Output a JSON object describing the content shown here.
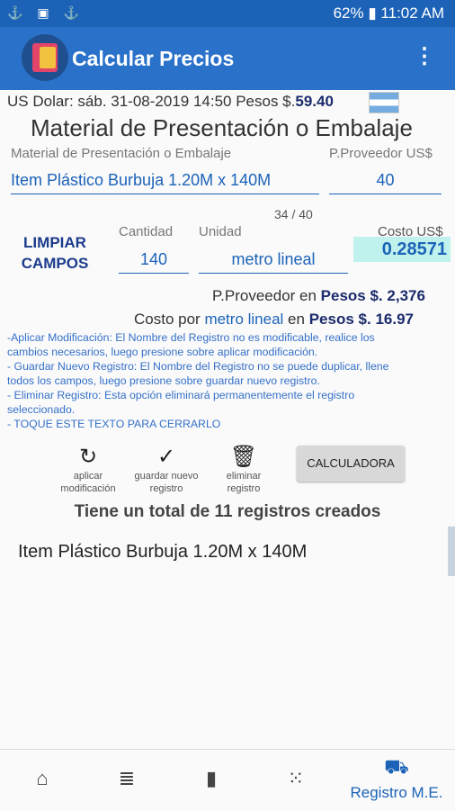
{
  "status": {
    "left_icons": "⚓ ▣ ⚓",
    "right": "62% ▮ 11:02 AM"
  },
  "appbar": {
    "title": "Calcular Precios",
    "menu_icon": "⋮"
  },
  "rate": {
    "prefix": "US Dolar: sáb. 31-08-2019 14:50 Pesos $.",
    "value": "59.40"
  },
  "heading": "Material de Presentación o Embalaje",
  "form": {
    "material_label": "Material de Presentación o Embalaje",
    "material_value": "Item Plástico Burbuja 1.20M x 140M",
    "proveedor_label": "P.Proveedor US$",
    "proveedor_value": "40",
    "counter": "34 / 40",
    "limpiar": "LIMPIAR CAMPOS",
    "cantidad_label": "Cantidad",
    "cantidad_value": "140",
    "unidad_label": "Unidad",
    "unidad_value": "metro lineal",
    "costo_label": "Costo US$",
    "costo_value": "0.28571"
  },
  "summary": {
    "proveedor_pesos_label": "P.Proveedor en",
    "pesos_label": "Pesos $.",
    "proveedor_pesos_value": "2,376",
    "costo_por_label": "Costo por",
    "costo_por_unit": "metro lineal",
    "en_label": "en",
    "costo_por_value": "16.97"
  },
  "help": [
    "-Aplicar Modificación: El Nombre del Registro no es modificable, realice los",
    "cambios necesarios, luego presione sobre aplicar modificación.",
    "- Guardar Nuevo Registro: El Nombre del Registro no se puede duplicar, llene",
    "todos los campos, luego presione sobre guardar nuevo registro.",
    "- Eliminar Registro: Esta opción eliminará permanentemente el registro",
    "seleccionado.",
    "- TOQUE ESTE TEXTO PARA CERRARLO"
  ],
  "actions": {
    "aplicar": "aplicar modificación",
    "guardar": "guardar nuevo registro",
    "eliminar": "eliminar registro",
    "calculadora": "CALCULADORA"
  },
  "total": "Tiene un total de 11 registros creados",
  "records": [
    "Item Plástico Burbuja 1.20M x 140M"
  ],
  "nav": {
    "active_label": "Registro M.E."
  },
  "colors": {
    "primary": "#2a72c9",
    "statusbar": "#1c63b8",
    "highlight": "#bff2ec"
  }
}
